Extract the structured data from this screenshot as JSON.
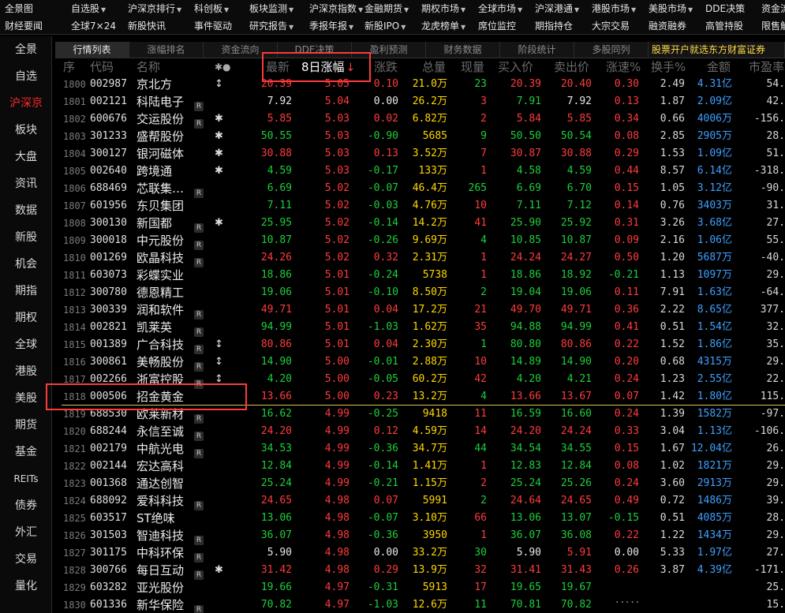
{
  "menu": {
    "row1": [
      {
        "label": "全景图",
        "caret": false
      },
      {
        "label": "自选股",
        "caret": true
      },
      {
        "label": "沪深京排行",
        "caret": true
      },
      {
        "label": "科创板",
        "caret": true
      },
      {
        "label": "板块监测",
        "caret": true
      },
      {
        "label": "沪深京指数",
        "caret": true
      },
      {
        "label": "金融期货",
        "caret": true
      },
      {
        "label": "期权市场",
        "caret": true
      },
      {
        "label": "全球市场",
        "caret": true
      },
      {
        "label": "沪深港通",
        "caret": true
      },
      {
        "label": "港股市场",
        "caret": true
      },
      {
        "label": "美股市场",
        "caret": true
      },
      {
        "label": "DDE决策",
        "caret": false
      },
      {
        "label": "资金流",
        "caret": false
      }
    ],
    "row2": [
      {
        "label": "财经要闻",
        "caret": false
      },
      {
        "label": "全球7×24",
        "caret": false
      },
      {
        "label": "新股快讯",
        "caret": false
      },
      {
        "label": "事件驱动",
        "caret": false
      },
      {
        "label": "研究报告",
        "caret": true
      },
      {
        "label": "季报年报",
        "caret": true
      },
      {
        "label": "新股IPO",
        "caret": true
      },
      {
        "label": "龙虎榜单",
        "caret": true
      },
      {
        "label": "席位监控",
        "caret": false
      },
      {
        "label": "期指持仓",
        "caret": false
      },
      {
        "label": "大宗交易",
        "caret": false
      },
      {
        "label": "融资融券",
        "caret": false
      },
      {
        "label": "高管持股",
        "caret": false
      },
      {
        "label": "限售解",
        "caret": false
      }
    ]
  },
  "sidenav": [
    "全景",
    "自选",
    "沪深京",
    "板块",
    "大盘",
    "资讯",
    "数据",
    "新股",
    "机会",
    "期指",
    "期权",
    "全球",
    "港股",
    "美股",
    "期货",
    "基金",
    "REITs",
    "债券",
    "外汇",
    "交易",
    "量化"
  ],
  "sidenav_active": "沪深京",
  "tabs": [
    "行情列表",
    "涨幅排名",
    "资金流向",
    "DDE决策",
    "盈利预测",
    "财务数据",
    "阶段统计",
    "多股同列"
  ],
  "tab_active": "行情列表",
  "ad_text": "股票开户就选东方财富证券",
  "columns": {
    "seq": "序",
    "code": "代码",
    "name": "名称",
    "marks": "✱●",
    "price": "最新",
    "pct": "8日涨幅",
    "sort_arrow": "↓",
    "chg": "涨跌",
    "vol": "总量",
    "now": "现量",
    "bid": "买入价",
    "ask": "卖出价",
    "speed": "涨速%",
    "turnover": "换手%",
    "amount": "金额",
    "pe": "市盈率"
  },
  "rows": [
    {
      "seq": "1800",
      "code": "002987",
      "name": "京北方",
      "badge": "",
      "mark": "↕",
      "price": "20.39",
      "pct": "5.05",
      "chg": "0.10",
      "vol": "21.0万",
      "now": "23",
      "bid": "20.39",
      "ask": "20.40",
      "speed": "0.30",
      "turn": "2.49",
      "amt": "4.31亿",
      "pe": "54."
    },
    {
      "seq": "1801",
      "code": "002121",
      "name": "科陆电子",
      "badge": "R",
      "mark": "",
      "price": "7.92",
      "pct": "5.04",
      "chg": "0.00",
      "vol": "26.2万",
      "now": "3",
      "bid": "7.91",
      "ask": "7.92",
      "speed": "0.13",
      "turn": "1.87",
      "amt": "2.09亿",
      "pe": "42."
    },
    {
      "seq": "1802",
      "code": "600676",
      "name": "交运股份",
      "badge": "R",
      "mark": "✱",
      "price": "5.85",
      "pct": "5.03",
      "chg": "0.02",
      "vol": "6.82万",
      "now": "2",
      "bid": "5.84",
      "ask": "5.85",
      "speed": "0.34",
      "turn": "0.66",
      "amt": "4006万",
      "pe": "-156."
    },
    {
      "seq": "1803",
      "code": "301233",
      "name": "盛帮股份",
      "badge": "",
      "mark": "✱",
      "price": "50.55",
      "pct": "5.03",
      "chg": "-0.90",
      "vol": "5685",
      "now": "9",
      "bid": "50.50",
      "ask": "50.54",
      "speed": "0.08",
      "turn": "2.85",
      "amt": "2905万",
      "pe": "28."
    },
    {
      "seq": "1804",
      "code": "300127",
      "name": "银河磁体",
      "badge": "",
      "mark": "✱",
      "price": "30.88",
      "pct": "5.03",
      "chg": "0.13",
      "vol": "3.52万",
      "now": "7",
      "bid": "30.87",
      "ask": "30.88",
      "speed": "0.29",
      "turn": "1.53",
      "amt": "1.09亿",
      "pe": "51."
    },
    {
      "seq": "1805",
      "code": "002640",
      "name": "跨境通",
      "badge": "",
      "mark": "✱",
      "price": "4.59",
      "pct": "5.03",
      "chg": "-0.17",
      "vol": "133万",
      "now": "1",
      "bid": "4.58",
      "ask": "4.59",
      "speed": "0.44",
      "turn": "8.57",
      "amt": "6.14亿",
      "pe": "-318."
    },
    {
      "seq": "1806",
      "code": "688469",
      "name": "芯联集…",
      "badge": "R",
      "mark": "",
      "price": "6.69",
      "pct": "5.02",
      "chg": "-0.07",
      "vol": "46.4万",
      "now": "265",
      "bid": "6.69",
      "ask": "6.70",
      "speed": "0.15",
      "turn": "1.05",
      "amt": "3.12亿",
      "pe": "-90."
    },
    {
      "seq": "1807",
      "code": "601956",
      "name": "东贝集团",
      "badge": "",
      "mark": "",
      "price": "7.11",
      "pct": "5.02",
      "chg": "-0.03",
      "vol": "4.76万",
      "now": "10",
      "bid": "7.11",
      "ask": "7.12",
      "speed": "0.14",
      "turn": "0.76",
      "amt": "3403万",
      "pe": "31."
    },
    {
      "seq": "1808",
      "code": "300130",
      "name": "新国都",
      "badge": "R",
      "mark": "✱",
      "price": "25.95",
      "pct": "5.02",
      "chg": "-0.14",
      "vol": "14.2万",
      "now": "41",
      "bid": "25.90",
      "ask": "25.92",
      "speed": "0.31",
      "turn": "3.26",
      "amt": "3.68亿",
      "pe": "27."
    },
    {
      "seq": "1809",
      "code": "300018",
      "name": "中元股份",
      "badge": "R",
      "mark": "",
      "price": "10.87",
      "pct": "5.02",
      "chg": "-0.26",
      "vol": "9.69万",
      "now": "4",
      "bid": "10.85",
      "ask": "10.87",
      "speed": "0.09",
      "turn": "2.16",
      "amt": "1.06亿",
      "pe": "55."
    },
    {
      "seq": "1810",
      "code": "001269",
      "name": "欧晶科技",
      "badge": "R",
      "mark": "",
      "price": "24.26",
      "pct": "5.02",
      "chg": "0.32",
      "vol": "2.31万",
      "now": "1",
      "bid": "24.24",
      "ask": "24.27",
      "speed": "0.50",
      "turn": "1.20",
      "amt": "5687万",
      "pe": "-40."
    },
    {
      "seq": "1811",
      "code": "603073",
      "name": "彩蝶实业",
      "badge": "",
      "mark": "",
      "price": "18.86",
      "pct": "5.01",
      "chg": "-0.24",
      "vol": "5738",
      "now": "1",
      "bid": "18.86",
      "ask": "18.92",
      "speed": "-0.21",
      "turn": "1.13",
      "amt": "1097万",
      "pe": "29."
    },
    {
      "seq": "1812",
      "code": "300780",
      "name": "德恩精工",
      "badge": "",
      "mark": "",
      "price": "19.06",
      "pct": "5.01",
      "chg": "-0.10",
      "vol": "8.50万",
      "now": "2",
      "bid": "19.04",
      "ask": "19.06",
      "speed": "0.11",
      "turn": "7.91",
      "amt": "1.63亿",
      "pe": "-64."
    },
    {
      "seq": "1813",
      "code": "300339",
      "name": "润和软件",
      "badge": "R",
      "mark": "",
      "price": "49.71",
      "pct": "5.01",
      "chg": "0.04",
      "vol": "17.2万",
      "now": "21",
      "bid": "49.70",
      "ask": "49.71",
      "speed": "0.36",
      "turn": "2.22",
      "amt": "8.65亿",
      "pe": "377."
    },
    {
      "seq": "1814",
      "code": "002821",
      "name": "凯莱英",
      "badge": "R",
      "mark": "",
      "price": "94.99",
      "pct": "5.01",
      "chg": "-1.03",
      "vol": "1.62万",
      "now": "35",
      "bid": "94.88",
      "ask": "94.99",
      "speed": "0.41",
      "turn": "0.51",
      "amt": "1.54亿",
      "pe": "32."
    },
    {
      "seq": "1815",
      "code": "001389",
      "name": "广合科技",
      "badge": "R",
      "mark": "↕",
      "price": "80.86",
      "pct": "5.01",
      "chg": "0.04",
      "vol": "2.30万",
      "now": "1",
      "bid": "80.80",
      "ask": "80.86",
      "speed": "0.22",
      "turn": "1.52",
      "amt": "1.86亿",
      "pe": "35."
    },
    {
      "seq": "1816",
      "code": "300861",
      "name": "美畅股份",
      "badge": "R",
      "mark": "↕",
      "price": "14.90",
      "pct": "5.00",
      "chg": "-0.01",
      "vol": "2.88万",
      "now": "10",
      "bid": "14.89",
      "ask": "14.90",
      "speed": "0.20",
      "turn": "0.68",
      "amt": "4315万",
      "pe": "29."
    },
    {
      "seq": "1817",
      "code": "002266",
      "name": "浙富控股",
      "badge": "R",
      "mark": "↕",
      "price": "4.20",
      "pct": "5.00",
      "chg": "-0.05",
      "vol": "60.2万",
      "now": "42",
      "bid": "4.20",
      "ask": "4.21",
      "speed": "0.24",
      "turn": "1.23",
      "amt": "2.55亿",
      "pe": "22."
    },
    {
      "seq": "1818",
      "code": "000506",
      "name": "招金黄金",
      "badge": "",
      "mark": "",
      "price": "13.66",
      "pct": "5.00",
      "chg": "0.23",
      "vol": "13.2万",
      "now": "4",
      "bid": "13.66",
      "ask": "13.67",
      "speed": "0.07",
      "turn": "1.42",
      "amt": "1.80亿",
      "pe": "115."
    },
    {
      "seq": "1819",
      "code": "688530",
      "name": "欧莱新材",
      "badge": "R",
      "mark": "",
      "price": "16.62",
      "pct": "4.99",
      "chg": "-0.25",
      "vol": "9418",
      "now": "11",
      "bid": "16.59",
      "ask": "16.60",
      "speed": "0.24",
      "turn": "1.39",
      "amt": "1582万",
      "pe": "-97."
    },
    {
      "seq": "1820",
      "code": "688244",
      "name": "永信至诚",
      "badge": "R",
      "mark": "",
      "price": "24.20",
      "pct": "4.99",
      "chg": "0.12",
      "vol": "4.59万",
      "now": "14",
      "bid": "24.20",
      "ask": "24.24",
      "speed": "0.33",
      "turn": "3.04",
      "amt": "1.13亿",
      "pe": "-106."
    },
    {
      "seq": "1821",
      "code": "002179",
      "name": "中航光电",
      "badge": "R",
      "mark": "",
      "price": "34.53",
      "pct": "4.99",
      "chg": "-0.36",
      "vol": "34.7万",
      "now": "44",
      "bid": "34.54",
      "ask": "34.55",
      "speed": "0.15",
      "turn": "1.67",
      "amt": "12.04亿",
      "pe": "26."
    },
    {
      "seq": "1822",
      "code": "002144",
      "name": "宏达高科",
      "badge": "",
      "mark": "",
      "price": "12.84",
      "pct": "4.99",
      "chg": "-0.14",
      "vol": "1.41万",
      "now": "1",
      "bid": "12.83",
      "ask": "12.84",
      "speed": "0.08",
      "turn": "1.02",
      "amt": "1821万",
      "pe": "29."
    },
    {
      "seq": "1823",
      "code": "001368",
      "name": "通达创智",
      "badge": "",
      "mark": "",
      "price": "25.24",
      "pct": "4.99",
      "chg": "-0.21",
      "vol": "1.15万",
      "now": "2",
      "bid": "25.24",
      "ask": "25.26",
      "speed": "0.24",
      "turn": "3.60",
      "amt": "2913万",
      "pe": "29."
    },
    {
      "seq": "1824",
      "code": "688092",
      "name": "爱科科技",
      "badge": "R",
      "mark": "",
      "price": "24.65",
      "pct": "4.98",
      "chg": "0.07",
      "vol": "5991",
      "now": "2",
      "bid": "24.64",
      "ask": "24.65",
      "speed": "0.49",
      "turn": "0.72",
      "amt": "1486万",
      "pe": "39."
    },
    {
      "seq": "1825",
      "code": "603517",
      "name": "ST绝味",
      "badge": "",
      "mark": "",
      "price": "13.06",
      "pct": "4.98",
      "chg": "-0.07",
      "vol": "3.10万",
      "now": "66",
      "bid": "13.06",
      "ask": "13.07",
      "speed": "-0.15",
      "turn": "0.51",
      "amt": "4085万",
      "pe": "28."
    },
    {
      "seq": "1826",
      "code": "301503",
      "name": "智迪科技",
      "badge": "R",
      "mark": "",
      "price": "36.07",
      "pct": "4.98",
      "chg": "-0.36",
      "vol": "3950",
      "now": "1",
      "bid": "36.07",
      "ask": "36.08",
      "speed": "0.22",
      "turn": "1.22",
      "amt": "1434万",
      "pe": "29."
    },
    {
      "seq": "1827",
      "code": "301175",
      "name": "中科环保",
      "badge": "R",
      "mark": "",
      "price": "5.90",
      "pct": "4.98",
      "chg": "0.00",
      "vol": "33.2万",
      "now": "30",
      "bid": "5.90",
      "ask": "5.91",
      "speed": "0.00",
      "turn": "5.33",
      "amt": "1.97亿",
      "pe": "27."
    },
    {
      "seq": "1828",
      "code": "300766",
      "name": "每日互动",
      "badge": "R",
      "mark": "✱",
      "price": "31.42",
      "pct": "4.98",
      "chg": "0.29",
      "vol": "13.9万",
      "now": "32",
      "bid": "31.41",
      "ask": "31.43",
      "speed": "0.26",
      "turn": "3.87",
      "amt": "4.39亿",
      "pe": "-171."
    },
    {
      "seq": "1829",
      "code": "603282",
      "name": "亚光股份",
      "badge": "",
      "mark": "",
      "price": "19.66",
      "pct": "4.97",
      "chg": "-0.31",
      "vol": "5913",
      "now": "17",
      "bid": "19.65",
      "ask": "19.67",
      "speed": "",
      "turn": "",
      "amt": "",
      "pe": "25."
    },
    {
      "seq": "1830",
      "code": "601336",
      "name": "新华保险",
      "badge": "R",
      "mark": "",
      "price": "70.82",
      "pct": "4.97",
      "chg": "-1.03",
      "vol": "12.6万",
      "now": "11",
      "bid": "70.81",
      "ask": "70.82",
      "speed": "",
      "turn": "",
      "amt": "",
      "pe": "15."
    }
  ],
  "watermark": "·····"
}
